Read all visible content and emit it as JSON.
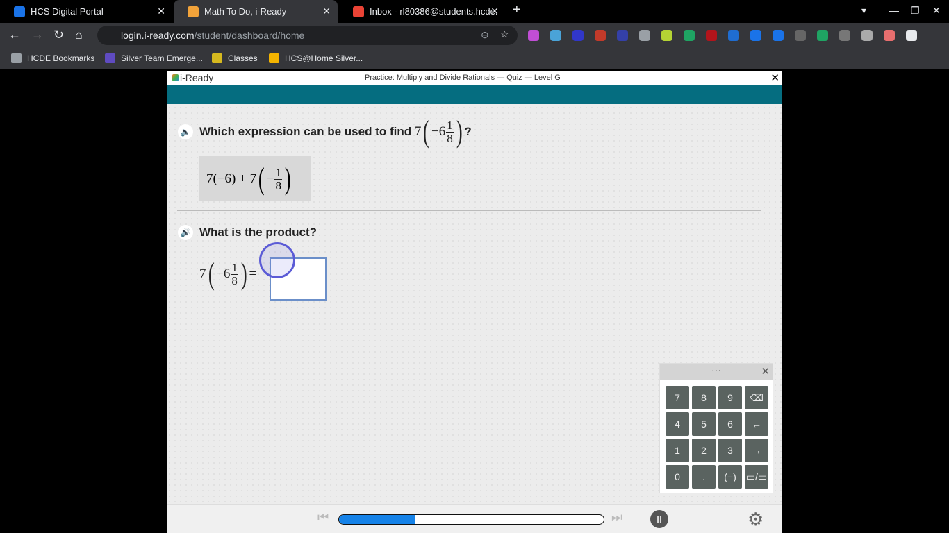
{
  "browser": {
    "tabs": [
      {
        "title": "HCS Digital Portal",
        "icon": "#1a73e8"
      },
      {
        "title": "Math To Do, i-Ready",
        "icon": "#f2a33a"
      },
      {
        "title": "Inbox - rl80386@students.hcde.",
        "icon": "#ea4335"
      }
    ],
    "new_tab": "+",
    "url_host": "login.i-ready.com",
    "url_path": "/student/dashboard/home",
    "bookmarks": [
      {
        "label": "HCDE Bookmarks",
        "color": "#9aa0a6"
      },
      {
        "label": "Silver Team Emerge...",
        "color": "#5f4bc1"
      },
      {
        "label": "Classes",
        "color": "#d6b91f"
      },
      {
        "label": "HCS@Home Silver...",
        "color": "#f4b400"
      }
    ],
    "extension_colors": [
      "#c14ed6",
      "#4aa3d8",
      "#3137c9",
      "#c23a2a",
      "#3440a8",
      "#9aa0a6",
      "#b4d334",
      "#1fa463",
      "#b3141b",
      "#1f6dd1",
      "#1a73e8",
      "#1a73e8",
      "#666",
      "#1fa463",
      "#777",
      "#aaa",
      "#e86e6e",
      "#e8eaed"
    ]
  },
  "app": {
    "logo": "i-Ready",
    "title": "Practice: Multiply and Divide Rationals — Quiz — Level G",
    "close": "✕",
    "question1": {
      "text": "Which expression can be used to find",
      "whole": "7",
      "mixed_whole": "−6",
      "num": "1",
      "den": "8",
      "end": "?"
    },
    "answer": {
      "a": "7(−6) + 7",
      "neg": "−",
      "num": "1",
      "den": "8"
    },
    "question2": {
      "text": "What is the product?",
      "whole": "7",
      "mixed_whole": "−6",
      "num": "1",
      "den": "8",
      "eq": "="
    },
    "keypad": {
      "handle": "···",
      "close": "✕",
      "keys": [
        "7",
        "8",
        "9",
        "⌫",
        "4",
        "5",
        "6",
        "←",
        "1",
        "2",
        "3",
        "→",
        "0",
        ".",
        "(−)",
        "▭/▭"
      ]
    },
    "progress_percent": 29,
    "pause": "II",
    "settings": "⚙"
  }
}
